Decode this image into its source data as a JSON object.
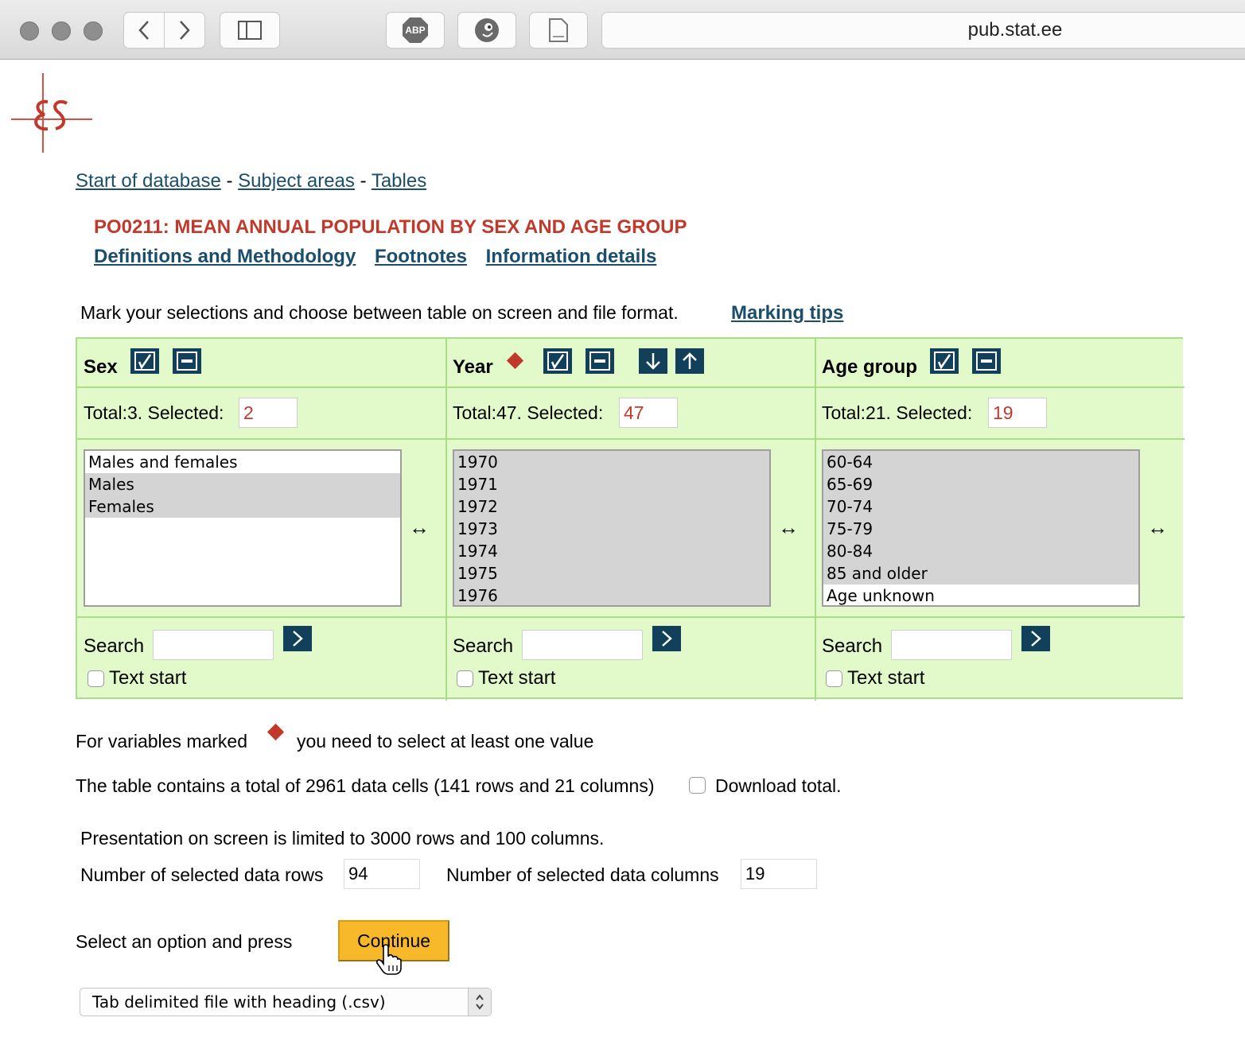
{
  "browser": {
    "url": "pub.stat.ee",
    "adblock_label": "ABP"
  },
  "logo": {
    "text": "ES"
  },
  "breadcrumb": {
    "start": "Start of database",
    "sep": "-",
    "subjects": "Subject areas",
    "tables": "Tables"
  },
  "title": "PO0211: MEAN ANNUAL POPULATION BY SEX AND AGE GROUP",
  "links": {
    "definitions": "Definitions and Methodology",
    "footnotes": "Footnotes",
    "information": "Information details"
  },
  "instruction": "Mark your selections and choose between table on screen and file format.",
  "marking_tips": "Marking tips",
  "variables": [
    {
      "name": "Sex",
      "total_text": "Total:3. Selected:",
      "selected": "2",
      "options": [
        {
          "label": "Males and females",
          "selected": false
        },
        {
          "label": "Males",
          "selected": true
        },
        {
          "label": "Females",
          "selected": true
        }
      ]
    },
    {
      "name": "Year",
      "mandatory": true,
      "total_text": "Total:47. Selected:",
      "selected": "47",
      "options": [
        {
          "label": "1970",
          "selected": true
        },
        {
          "label": "1971",
          "selected": true
        },
        {
          "label": "1972",
          "selected": true
        },
        {
          "label": "1973",
          "selected": true
        },
        {
          "label": "1974",
          "selected": true
        },
        {
          "label": "1975",
          "selected": true
        },
        {
          "label": "1976",
          "selected": true
        }
      ]
    },
    {
      "name": "Age group",
      "total_text": "Total:21. Selected:",
      "selected": "19",
      "options": [
        {
          "label": "60-64",
          "selected": true
        },
        {
          "label": "65-69",
          "selected": true
        },
        {
          "label": "70-74",
          "selected": true
        },
        {
          "label": "75-79",
          "selected": true
        },
        {
          "label": "80-84",
          "selected": true
        },
        {
          "label": "85 and older",
          "selected": true
        },
        {
          "label": "Age unknown",
          "selected": false
        }
      ]
    }
  ],
  "resize_glyph": "↔",
  "search_label": "Search",
  "text_start_label": "Text start",
  "mandatory_note_pre": "For variables marked",
  "mandatory_note_post": "you need to select at least one value",
  "cells_text": "The table contains a total of 2961 data cells (141 rows and 21 columns)",
  "download_total": "Download total.",
  "limit_text": "Presentation on screen is limited to 3000 rows and 100 columns.",
  "rows_label": "Number of selected data rows",
  "rows_value": "94",
  "cols_label": "Number of selected data columns",
  "cols_value": "19",
  "select_prompt": "Select an option and press",
  "continue_label": "Continue",
  "format_selected": "Tab delimited file with heading (.csv)",
  "colors": {
    "panel_bg": "#e2fac9",
    "panel_border": "#a8df86",
    "accent_red": "#c0392b",
    "link_blue": "#1a4e6b",
    "button_dark": "#12405a",
    "continue_bg": "#f7b92a"
  }
}
